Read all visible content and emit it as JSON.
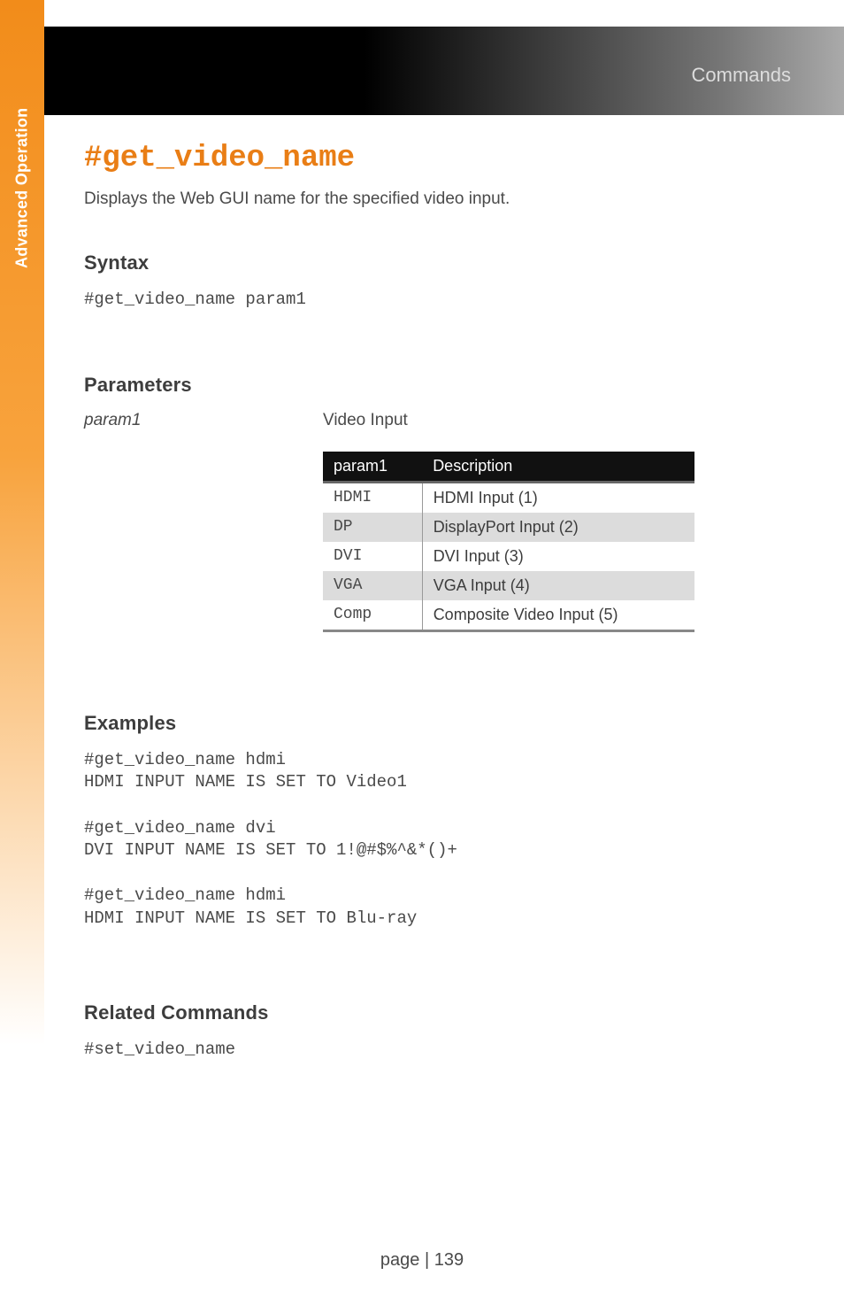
{
  "sidebar": {
    "label": "Advanced Operation"
  },
  "header": {
    "breadcrumb": "Commands"
  },
  "command": {
    "title": "#get_video_name",
    "description": "Displays the Web GUI name for the specified video input."
  },
  "syntax": {
    "heading": "Syntax",
    "code": "#get_video_name param1"
  },
  "parameters": {
    "heading": "Parameters",
    "param_name": "param1",
    "param_desc": "Video Input",
    "table": {
      "headers": {
        "col1": "param1",
        "col2": "Description"
      },
      "rows": [
        {
          "code": "HDMI",
          "desc": "HDMI Input (1)"
        },
        {
          "code": "DP",
          "desc": "DisplayPort Input (2)"
        },
        {
          "code": "DVI",
          "desc": "DVI Input (3)"
        },
        {
          "code": "VGA",
          "desc": "VGA Input (4)"
        },
        {
          "code": "Comp",
          "desc": "Composite Video Input (5)"
        }
      ]
    }
  },
  "examples": {
    "heading": "Examples",
    "code": "#get_video_name hdmi\nHDMI INPUT NAME IS SET TO Video1\n\n#get_video_name dvi\nDVI INPUT NAME IS SET TO 1!@#$%^&*()+\n\n#get_video_name hdmi\nHDMI INPUT NAME IS SET TO Blu-ray"
  },
  "related": {
    "heading": "Related Commands",
    "code": "#set_video_name"
  },
  "footer": {
    "text": "page | 139"
  }
}
